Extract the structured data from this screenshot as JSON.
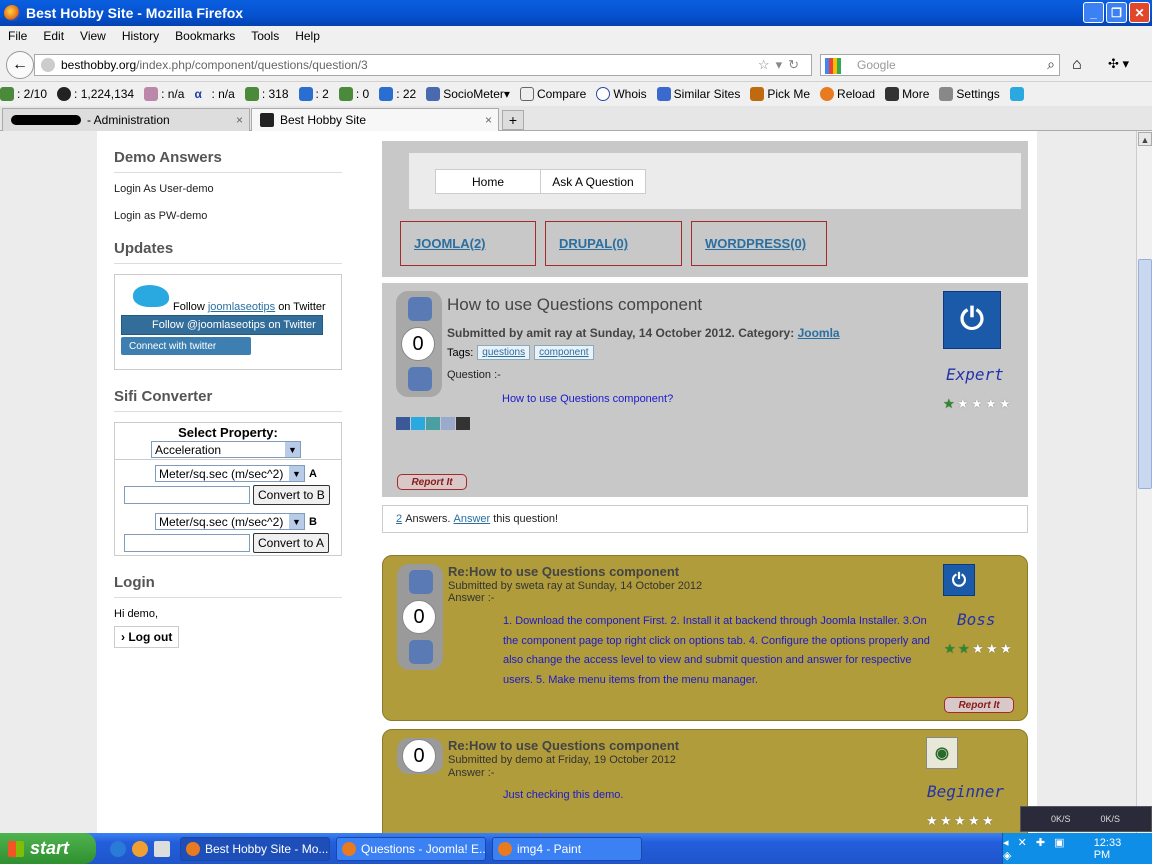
{
  "window": {
    "title": "Best Hobby Site - Mozilla Firefox",
    "controls": [
      "_",
      "❐",
      "✕"
    ]
  },
  "menubar": [
    "File",
    "Edit",
    "View",
    "History",
    "Bookmarks",
    "Tools",
    "Help"
  ],
  "navbar": {
    "url_domain": "besthobby.org",
    "url_path": "/index.php/component/questions/question/3",
    "search_placeholder": "Google"
  },
  "toolbar": {
    "items": [
      ": 2/10",
      ": 1,224,134",
      ": n/a",
      ": n/a",
      ": 318",
      ": 2",
      ": 0",
      ": 22",
      "SocioMeter",
      "Compare",
      "Whois",
      "Similar Sites",
      "Pick Me",
      "Reload",
      "More",
      "Settings"
    ]
  },
  "tabs": [
    {
      "label": "- Administration"
    },
    {
      "label": "Best Hobby Site"
    }
  ],
  "sidebar": {
    "demo": {
      "heading": "Demo Answers",
      "links": [
        "Login As User-demo",
        "Login as PW-demo"
      ]
    },
    "updates": {
      "heading": "Updates",
      "follow_prefix": "Follow",
      "follow_link": "joomlaseotips",
      "follow_suffix": "on Twitter",
      "btn_follow": "Follow @joomlaseotips on Twitter",
      "btn_connect": "Connect with twitter"
    },
    "sifi": {
      "heading": "Sifi Converter",
      "select_property": "Select Property:",
      "property_value": "Acceleration",
      "unit_a": "Meter/sq.sec (m/sec^2)",
      "label_a": "A",
      "convert_b": "Convert to B",
      "unit_b": "Meter/sq.sec (m/sec^2)",
      "label_b": "B",
      "convert_a": "Convert to A"
    },
    "login": {
      "heading": "Login",
      "greeting": "Hi demo,",
      "logout": "Log out"
    }
  },
  "main": {
    "menu": [
      "Home",
      "Ask A Question"
    ],
    "categories": [
      "JOOMLA(2)",
      "DRUPAL(0)",
      "WORDPRESS(0)"
    ],
    "question": {
      "votes": "0",
      "title": "How to use Questions component",
      "meta": "Submitted by amit ray at Sunday, 14 October 2012. Category:",
      "category": "Joomla",
      "tags_label": "Tags:",
      "tags": [
        "questions",
        "component"
      ],
      "question_label": "Question :-",
      "text": "How to use Questions component?",
      "rank": "Expert",
      "rating": 1,
      "report": "Report It"
    },
    "answers_bar": {
      "count": "2",
      "mid": "Answers.",
      "answer_link": "Answer",
      "suffix": "this question!"
    },
    "answers": [
      {
        "votes": "0",
        "title": "Re:How to use Questions component",
        "meta": "Submitted by sweta ray at Sunday, 14 October 2012",
        "label": "Answer :-",
        "text": "1. Download the component First. 2. Install it at backend through Joomla Installer. 3.On the component page top right click on options tab. 4. Configure the options properly and also change the access level to view and submit question and answer for respective users. 5. Make menu items from the menu manager.",
        "rank": "Boss",
        "rating": 2,
        "report": "Report It"
      },
      {
        "votes": "0",
        "title": "Re:How to use Questions component",
        "meta": "Submitted by demo at Friday, 19 October 2012",
        "label": "Answer :-",
        "text": "Just checking this demo.",
        "rank": "Beginner",
        "rating": 0
      }
    ]
  },
  "taskbar": {
    "start": "start",
    "tasks": [
      "Best Hobby Site - Mo...",
      "Questions - Joomla! E...",
      "img4 - Paint"
    ],
    "clock": "12:33 PM",
    "net": [
      "0K/S",
      "0K/S"
    ]
  }
}
